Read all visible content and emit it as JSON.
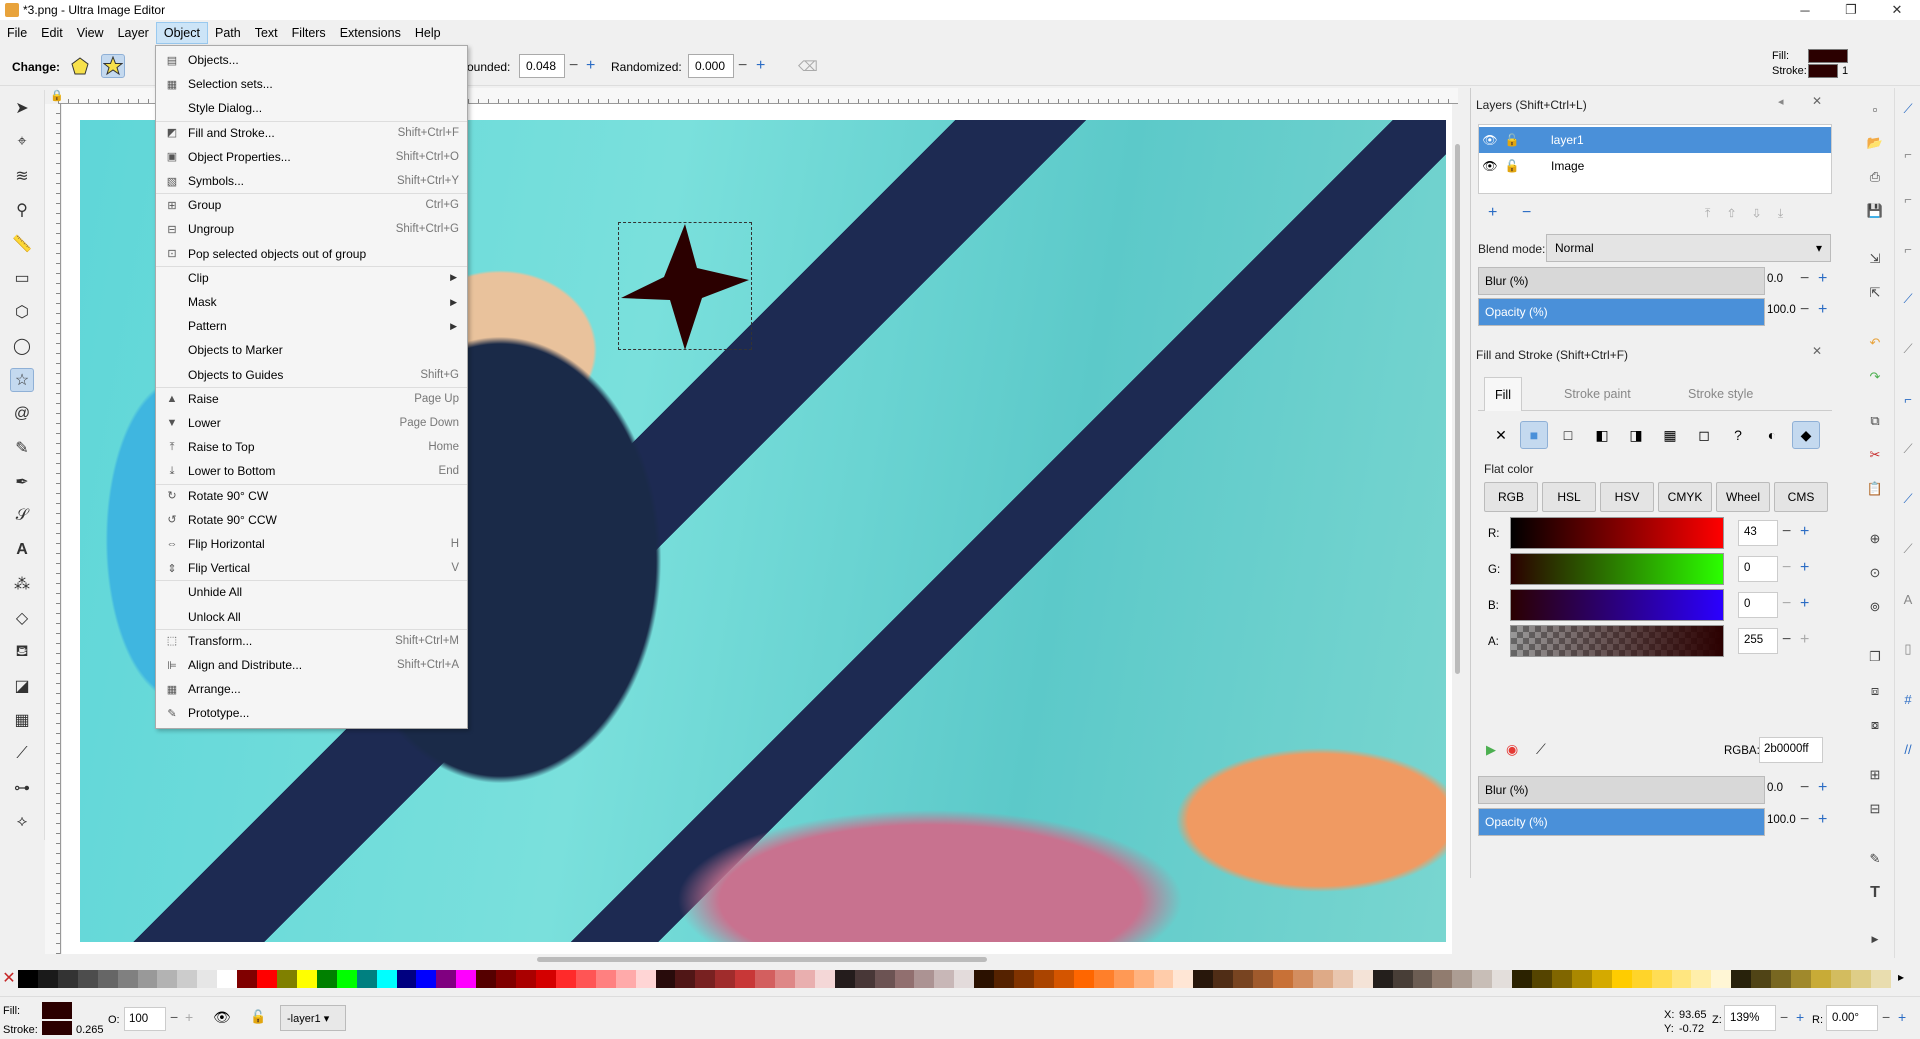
{
  "window": {
    "title": "*3.png - Ultra Image Editor",
    "min": "─",
    "restore": "❐",
    "close": "✕"
  },
  "menubar": [
    "File",
    "Edit",
    "View",
    "Layer",
    "Object",
    "Path",
    "Text",
    "Filters",
    "Extensions",
    "Help"
  ],
  "ctrlbar": {
    "change_label": "Change:",
    "rounded_label": "ounded:",
    "rounded_value": "0.048",
    "randomized_label": "Randomized:",
    "randomized_value": "0.000",
    "fill_label": "Fill:",
    "stroke_label": "Stroke:",
    "stroke_width": "1"
  },
  "object_menu": [
    {
      "label": "Objects...",
      "shortcut": "",
      "icon": "objects-icon",
      "glyph": "▤"
    },
    {
      "label": "Selection sets...",
      "shortcut": "",
      "icon": "selection-sets-icon",
      "glyph": "▦"
    },
    {
      "label": "Style Dialog...",
      "shortcut": "",
      "icon": "",
      "glyph": ""
    },
    {
      "label": "Fill and Stroke...",
      "shortcut": "Shift+Ctrl+F",
      "icon": "fill-stroke-icon",
      "glyph": "◩"
    },
    {
      "label": "Object Properties...",
      "shortcut": "Shift+Ctrl+O",
      "icon": "object-properties-icon",
      "glyph": "▣"
    },
    {
      "label": "Symbols...",
      "shortcut": "Shift+Ctrl+Y",
      "icon": "symbols-icon",
      "glyph": "▧"
    },
    {
      "label": "Group",
      "shortcut": "Ctrl+G",
      "icon": "group-icon",
      "glyph": "⊞"
    },
    {
      "label": "Ungroup",
      "shortcut": "Shift+Ctrl+G",
      "icon": "ungroup-icon",
      "glyph": "⊟"
    },
    {
      "label": "Pop selected objects out of group",
      "shortcut": "",
      "icon": "pop-group-icon",
      "glyph": "⊡"
    },
    {
      "label": "Clip",
      "shortcut": "",
      "icon": "",
      "glyph": "",
      "submenu": true
    },
    {
      "label": "Mask",
      "shortcut": "",
      "icon": "",
      "glyph": "",
      "submenu": true
    },
    {
      "label": "Pattern",
      "shortcut": "",
      "icon": "",
      "glyph": "",
      "submenu": true
    },
    {
      "label": "Objects to Marker",
      "shortcut": "",
      "icon": "",
      "glyph": ""
    },
    {
      "label": "Objects to Guides",
      "shortcut": "Shift+G",
      "icon": "",
      "glyph": ""
    },
    {
      "label": "Raise",
      "shortcut": "Page Up",
      "icon": "raise-icon",
      "glyph": "▲"
    },
    {
      "label": "Lower",
      "shortcut": "Page Down",
      "icon": "lower-icon",
      "glyph": "▼"
    },
    {
      "label": "Raise to Top",
      "shortcut": "Home",
      "icon": "raise-top-icon",
      "glyph": "⤒"
    },
    {
      "label": "Lower to Bottom",
      "shortcut": "End",
      "icon": "lower-bottom-icon",
      "glyph": "⤓"
    },
    {
      "label": "Rotate 90° CW",
      "shortcut": "",
      "icon": "rotate-cw-icon",
      "glyph": "↻"
    },
    {
      "label": "Rotate 90° CCW",
      "shortcut": "",
      "icon": "rotate-ccw-icon",
      "glyph": "↺"
    },
    {
      "label": "Flip Horizontal",
      "shortcut": "H",
      "icon": "flip-horizontal-icon",
      "glyph": "⇔"
    },
    {
      "label": "Flip Vertical",
      "shortcut": "V",
      "icon": "flip-vertical-icon",
      "glyph": "⇕"
    },
    {
      "label": "Unhide All",
      "shortcut": "",
      "icon": "",
      "glyph": ""
    },
    {
      "label": "Unlock All",
      "shortcut": "",
      "icon": "",
      "glyph": ""
    },
    {
      "label": "Transform...",
      "shortcut": "Shift+Ctrl+M",
      "icon": "transform-icon",
      "glyph": "⬚"
    },
    {
      "label": "Align and Distribute...",
      "shortcut": "Shift+Ctrl+A",
      "icon": "align-icon",
      "glyph": "⊫"
    },
    {
      "label": "Arrange...",
      "shortcut": "",
      "icon": "arrange-icon",
      "glyph": "▦"
    },
    {
      "label": "Prototype...",
      "shortcut": "",
      "icon": "prototype-icon",
      "glyph": "✎"
    }
  ],
  "layers_panel": {
    "title": "Layers (Shift+Ctrl+L)",
    "layers": [
      {
        "name": "layer1"
      },
      {
        "name": "Image"
      }
    ],
    "blend_label": "Blend mode:",
    "blend_value": "Normal",
    "blur_label": "Blur (%)",
    "blur_value": "0.0",
    "opacity_label": "Opacity (%)",
    "opacity_value": "100.0"
  },
  "fill_stroke_panel": {
    "title": "Fill and Stroke (Shift+Ctrl+F)",
    "tabs": [
      "Fill",
      "Stroke paint",
      "Stroke style"
    ],
    "paint_types": [
      "✕",
      "■",
      "□",
      "◧",
      "◨",
      "▦",
      "◻",
      "?",
      "◐",
      "◆"
    ],
    "flat_color_label": "Flat color",
    "modes": [
      "RGB",
      "HSL",
      "HSV",
      "CMYK",
      "Wheel",
      "CMS"
    ],
    "channels": [
      {
        "label": "R:",
        "value": "43"
      },
      {
        "label": "G:",
        "value": "0"
      },
      {
        "label": "B:",
        "value": "0"
      },
      {
        "label": "A:",
        "value": "255"
      }
    ],
    "rgba_label": "RGBA:",
    "rgba_value": "2b0000ff",
    "blur_label": "Blur (%)",
    "blur_value": "0.0",
    "opacity_label": "Opacity (%)",
    "opacity_value": "100.0"
  },
  "statusbar": {
    "fill_label": "Fill:",
    "stroke_label": "Stroke:",
    "stroke_width": "0.265",
    "opacity_label": "O:",
    "opacity_value": "100",
    "layer_value": "-layer1",
    "x_label": "X:",
    "x_value": "93.65",
    "y_label": "Y:",
    "y_value": "-0.72",
    "zoom_label": "Z:",
    "zoom_value": "139%",
    "rotation_label": "R:",
    "rotation_value": "0.00°"
  },
  "colors": {
    "fill": "#2b0000",
    "accent": "#4a90d9"
  },
  "palette": [
    "#000000",
    "#1a1a1a",
    "#333333",
    "#4d4d4d",
    "#666666",
    "#808080",
    "#999999",
    "#b3b3b3",
    "#cccccc",
    "#e6e6e6",
    "#ffffff",
    "#800000",
    "#ff0000",
    "#808000",
    "#ffff00",
    "#008000",
    "#00ff00",
    "#008080",
    "#00ffff",
    "#000080",
    "#0000ff",
    "#800080",
    "#ff00ff",
    "#550000",
    "#800000",
    "#aa0000",
    "#d40000",
    "#ff2a2a",
    "#ff5555",
    "#ff8080",
    "#ffaaaa",
    "#ffd5d5",
    "#280b0b",
    "#501616",
    "#782121",
    "#a02c2c",
    "#c83737",
    "#d35f5f",
    "#de8787",
    "#e9afaf",
    "#f4d7d7",
    "#241c1c",
    "#483737",
    "#6c5353",
    "#916f6f",
    "#ac9393",
    "#c8b7b7",
    "#e3dbdb",
    "#2b1100",
    "#552200",
    "#803300",
    "#aa4400",
    "#d45500",
    "#ff6600",
    "#ff7f2a",
    "#ff9955",
    "#ffb380",
    "#ffccaa",
    "#ffe6d5",
    "#28170b",
    "#502d16",
    "#784421",
    "#a05a2c",
    "#c87137",
    "#d38d5f",
    "#deaa87",
    "#e9c6af",
    "#f4e3d7",
    "#241f1c",
    "#483e37",
    "#6c5d53",
    "#917c6f",
    "#ac9d93",
    "#c8beb7",
    "#e3dedb",
    "#2b2200",
    "#554400",
    "#806600",
    "#aa8800",
    "#d4aa00",
    "#ffcc00",
    "#ffd42a",
    "#ffdd55",
    "#ffe680",
    "#ffeeaa",
    "#fff6d5",
    "#28220b",
    "#504416",
    "#786721",
    "#a0892c",
    "#c8ab37",
    "#d3bc5f",
    "#decd87",
    "#e9ddaf"
  ]
}
